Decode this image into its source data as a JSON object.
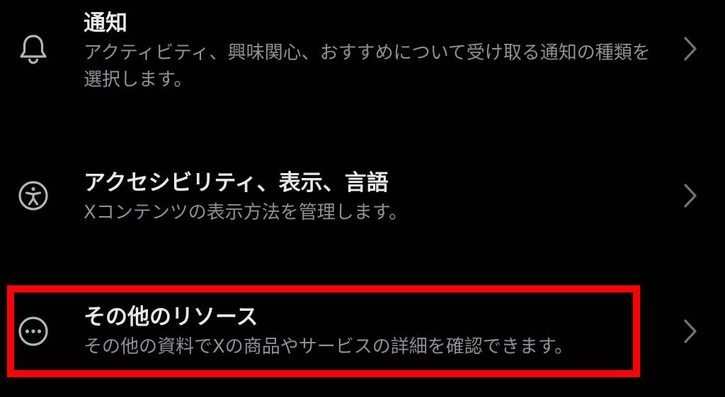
{
  "colors": {
    "background": "#000000",
    "title": "#e7e9ea",
    "description": "#8b9197",
    "icon": "#b0b5ba",
    "highlight": "#ff0000"
  },
  "settings": [
    {
      "icon": "bell-icon",
      "title": "通知",
      "description": "アクティビティ、興味関心、おすすめについて受け取る通知の種類を選択します。"
    },
    {
      "icon": "accessibility-icon",
      "title": "アクセシビリティ、表示、言語",
      "description": "Xコンテンツの表示方法を管理します。"
    },
    {
      "icon": "more-circle-icon",
      "title": "その他のリソース",
      "description": "その他の資料でXの商品やサービスの詳細を確認できます。"
    }
  ]
}
